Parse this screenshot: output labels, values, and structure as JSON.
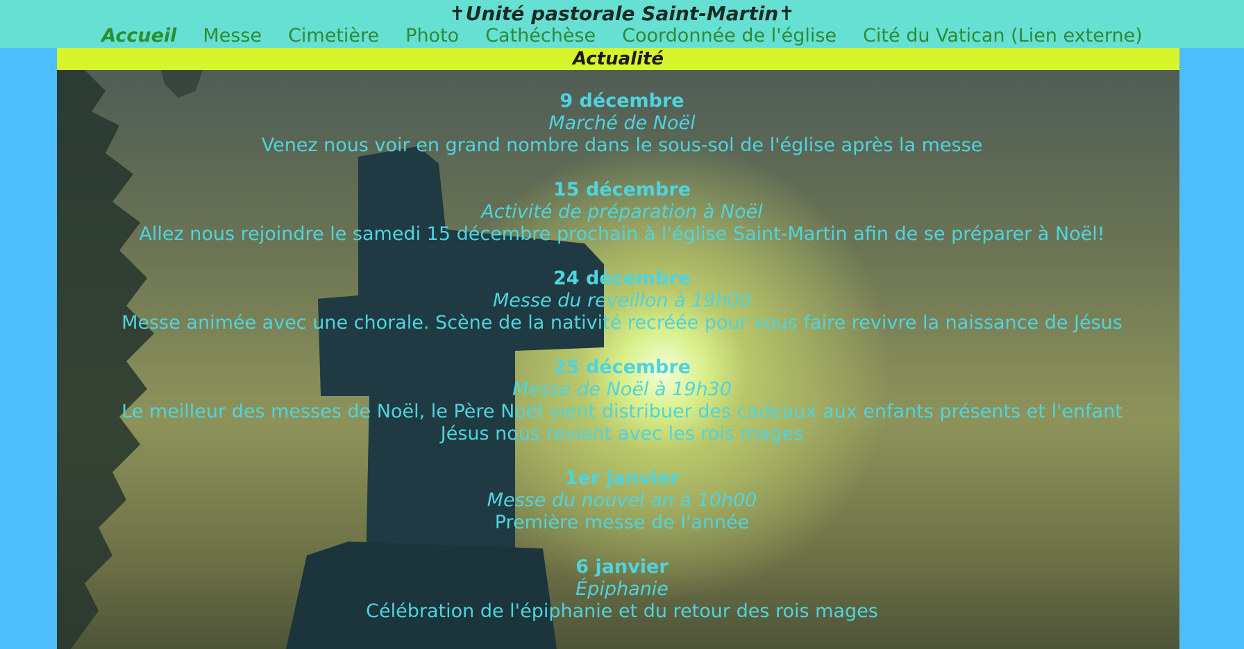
{
  "header": {
    "title": "✝Unité pastorale Saint-Martin✝",
    "nav": [
      {
        "label": "Accueil",
        "active": true
      },
      {
        "label": "Messe"
      },
      {
        "label": "Cimetière"
      },
      {
        "label": "Photo"
      },
      {
        "label": "Cathéchèse"
      },
      {
        "label": "Coordonnée de l'église"
      },
      {
        "label": "Cité du Vatican (Lien externe)"
      }
    ]
  },
  "section": {
    "title": "Actualité"
  },
  "events": [
    {
      "date": "9 décembre",
      "title": "Marché de Noël",
      "desc": "Venez nous voir en grand nombre dans le sous-sol de l'église après la messe"
    },
    {
      "date": "15 décembre",
      "title": "Activité de préparation à Noël",
      "desc": "Allez nous rejoindre le samedi 15 décembre prochain à l'église Saint-Martin afin de se préparer à Noël!"
    },
    {
      "date": "24 décembre",
      "title": "Messe du reveillon à 19h00",
      "desc": "Messe animée avec une chorale. Scène de la nativité recréée pour vous faire revivre la naissance de Jésus"
    },
    {
      "date": "25 décembre",
      "title": "Messe de Noël à 19h30",
      "desc": "Le meilleur des messes de Noël, le Père Noël vient distribuer des cadeaux aux enfants présents et l'enfant Jésus nous revient avec les rois mages"
    },
    {
      "date": "1er janvier",
      "title": "Messe du nouvel an à 10h00",
      "desc": "Première messe de l'année"
    },
    {
      "date": "6 janvier",
      "title": "Épiphanie",
      "desc": "Célébration de l'épiphanie et du retour des rois mages"
    }
  ],
  "colors": {
    "topbar": "#66e0d2",
    "section_bar": "#d6f52b",
    "background": "#4dbdfb",
    "event_text": "#4fd4de",
    "nav_link": "#2f8a36"
  }
}
